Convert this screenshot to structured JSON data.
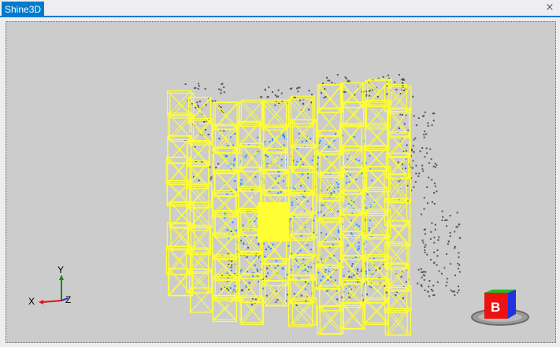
{
  "window": {
    "tab_title": "Shine3D",
    "close_glyph": "×"
  },
  "viewport": {
    "background_color": "#cccccc",
    "frame_color": "#ffff33",
    "target_color": "#1e8fff",
    "points_color": "#555555",
    "axes": {
      "x_label": "X",
      "y_label": "Y",
      "z_label": "Z",
      "x_color": "#e01010",
      "y_color": "#108a10",
      "z_color": "#1030e0"
    },
    "view_cube": {
      "face_label": "B",
      "front_color": "#ee1111",
      "top_color": "#22bb22",
      "side_color": "#2233dd"
    }
  }
}
